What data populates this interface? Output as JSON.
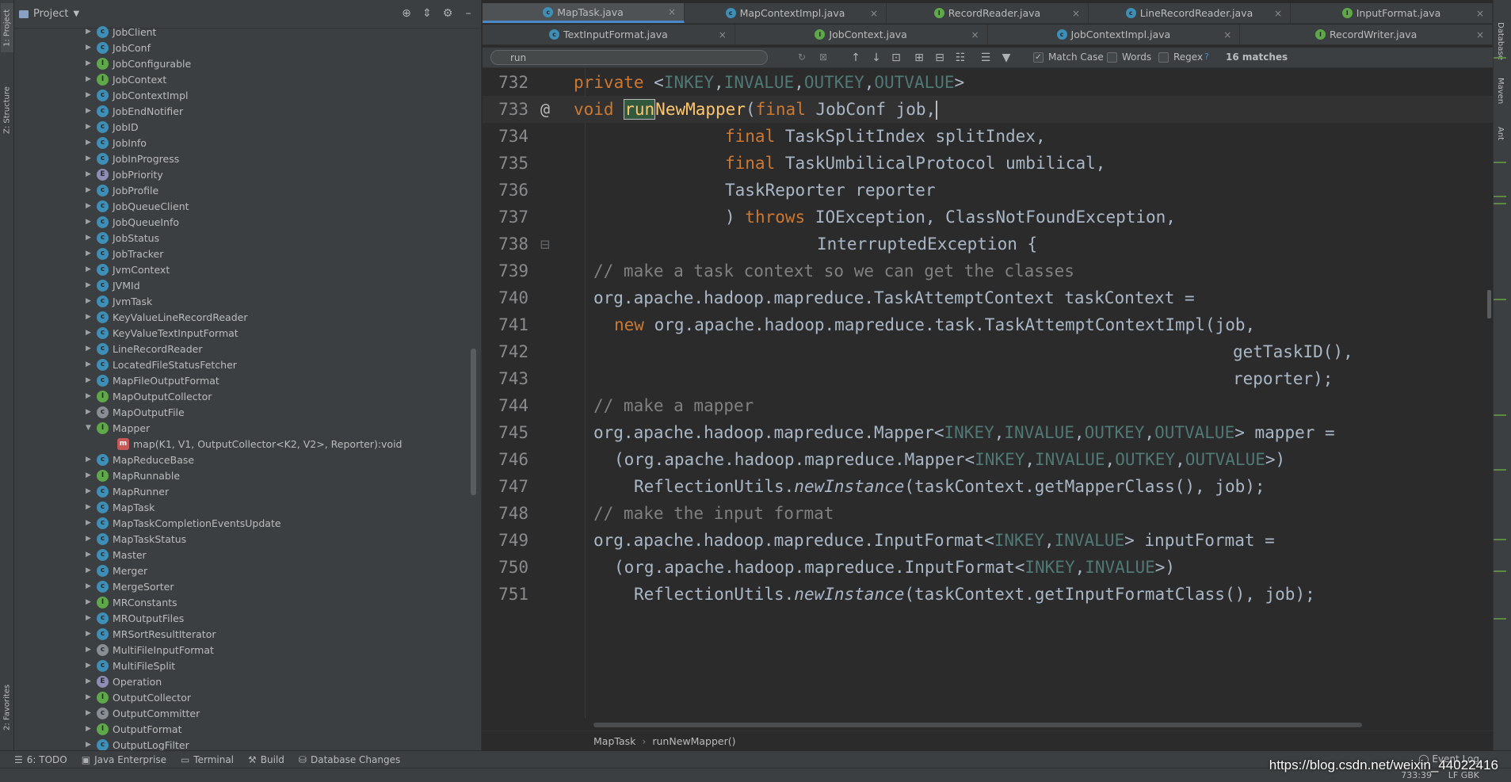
{
  "left_stripe": {
    "tabs": [
      "1: Project",
      "Z: Structure",
      "2: Favorites"
    ]
  },
  "project_panel": {
    "title": "Project",
    "tree": [
      {
        "name": "JobClient",
        "kind": "c"
      },
      {
        "name": "JobConf",
        "kind": "c"
      },
      {
        "name": "JobConfigurable",
        "kind": "i"
      },
      {
        "name": "JobContext",
        "kind": "i"
      },
      {
        "name": "JobContextImpl",
        "kind": "c"
      },
      {
        "name": "JobEndNotifier",
        "kind": "c"
      },
      {
        "name": "JobID",
        "kind": "c"
      },
      {
        "name": "JobInfo",
        "kind": "c"
      },
      {
        "name": "JobInProgress",
        "kind": "c"
      },
      {
        "name": "JobPriority",
        "kind": "e"
      },
      {
        "name": "JobProfile",
        "kind": "c"
      },
      {
        "name": "JobQueueClient",
        "kind": "c"
      },
      {
        "name": "JobQueueInfo",
        "kind": "c"
      },
      {
        "name": "JobStatus",
        "kind": "c"
      },
      {
        "name": "JobTracker",
        "kind": "c"
      },
      {
        "name": "JvmContext",
        "kind": "c"
      },
      {
        "name": "JVMId",
        "kind": "c"
      },
      {
        "name": "JvmTask",
        "kind": "c"
      },
      {
        "name": "KeyValueLineRecordReader",
        "kind": "c"
      },
      {
        "name": "KeyValueTextInputFormat",
        "kind": "c"
      },
      {
        "name": "LineRecordReader",
        "kind": "c"
      },
      {
        "name": "LocatedFileStatusFetcher",
        "kind": "c"
      },
      {
        "name": "MapFileOutputFormat",
        "kind": "c"
      },
      {
        "name": "MapOutputCollector",
        "kind": "i"
      },
      {
        "name": "MapOutputFile",
        "kind": "a"
      },
      {
        "name": "Mapper",
        "kind": "i",
        "expanded": true
      },
      {
        "name": "map(K1, V1, OutputCollector<K2, V2>, Reporter):void",
        "kind": "m",
        "child": true
      },
      {
        "name": "MapReduceBase",
        "kind": "c"
      },
      {
        "name": "MapRunnable",
        "kind": "i"
      },
      {
        "name": "MapRunner",
        "kind": "c"
      },
      {
        "name": "MapTask",
        "kind": "c"
      },
      {
        "name": "MapTaskCompletionEventsUpdate",
        "kind": "c"
      },
      {
        "name": "MapTaskStatus",
        "kind": "c"
      },
      {
        "name": "Master",
        "kind": "c"
      },
      {
        "name": "Merger",
        "kind": "c"
      },
      {
        "name": "MergeSorter",
        "kind": "c"
      },
      {
        "name": "MRConstants",
        "kind": "i"
      },
      {
        "name": "MROutputFiles",
        "kind": "c"
      },
      {
        "name": "MRSortResultIterator",
        "kind": "c"
      },
      {
        "name": "MultiFileInputFormat",
        "kind": "a"
      },
      {
        "name": "MultiFileSplit",
        "kind": "c"
      },
      {
        "name": "Operation",
        "kind": "e"
      },
      {
        "name": "OutputCollector",
        "kind": "i"
      },
      {
        "name": "OutputCommitter",
        "kind": "a"
      },
      {
        "name": "OutputFormat",
        "kind": "i"
      },
      {
        "name": "OutputLogFilter",
        "kind": "c"
      }
    ]
  },
  "editor": {
    "tabs_row1": [
      "MapTask.java",
      "MapContextImpl.java",
      "RecordReader.java",
      "LineRecordReader.java",
      "InputFormat.java"
    ],
    "tabs_row2": [
      "TextInputFormat.java",
      "JobContext.java",
      "JobContextImpl.java",
      "RecordWriter.java"
    ],
    "active_tab": "MapTask.java",
    "find": {
      "query": "run",
      "match_case_label": "Match Case",
      "words_label": "Words",
      "regex_label": "Regex",
      "regex_help": "?",
      "matches": "16 matches",
      "match_case_checked": true
    },
    "breadcrumb": [
      "MapTask",
      "runNewMapper()"
    ]
  },
  "bottom_bar": {
    "items": [
      "6: TODO",
      "Java Enterprise",
      "Terminal",
      "Build",
      "Database Changes"
    ],
    "event_log": "Event Log"
  },
  "status_bar": {
    "caret": "733:39",
    "encoding": "LF  GBK"
  },
  "right_stripe": {
    "tabs": [
      "Database",
      "Maven",
      "Ant"
    ]
  },
  "watermark": "https://blog.csdn.net/weixin_44022416"
}
